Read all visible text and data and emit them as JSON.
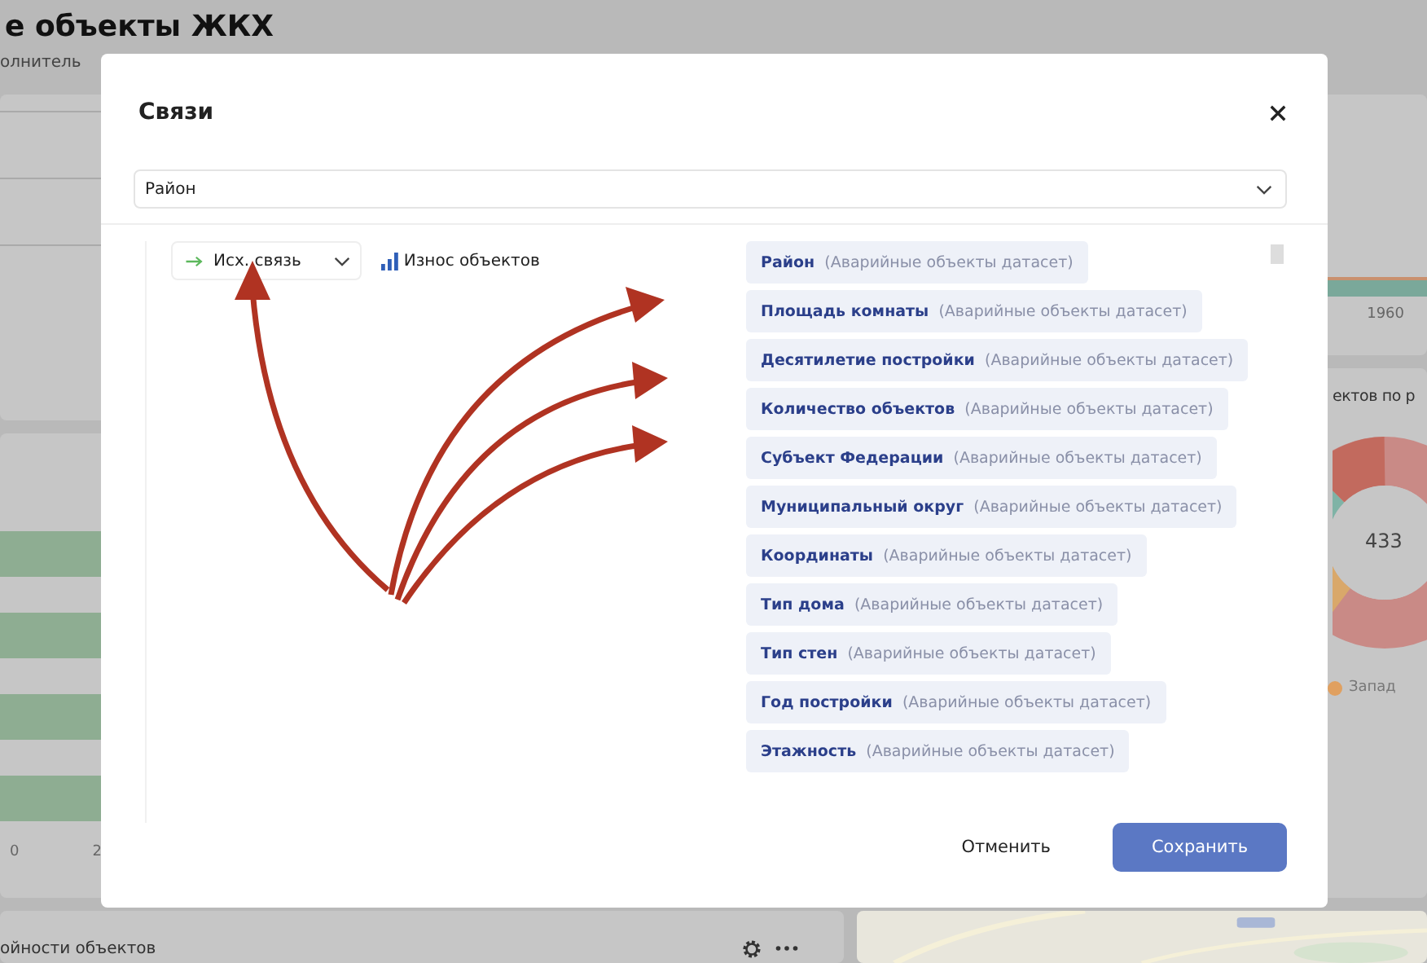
{
  "page": {
    "title": "е объекты ЖКХ",
    "tab": "олнитель"
  },
  "background": {
    "left_axis": [
      "0",
      "2"
    ],
    "area_chart_label": "1960",
    "donut_title": "ектов по р",
    "donut_total": "433",
    "legend_item": {
      "label": "Запад",
      "color": "#e0a060"
    },
    "bottom_card_title": "ойности объектов"
  },
  "dialog": {
    "title": "Связи",
    "dataset_select": {
      "value": "Район"
    },
    "link_type": {
      "label": "Исх. связь"
    },
    "chart_name": "Износ объектов",
    "fields": [
      {
        "name": "Район",
        "source": "(Аварийные объекты датасет)"
      },
      {
        "name": "Площадь комнаты",
        "source": "(Аварийные объекты датасет)"
      },
      {
        "name": "Десятилетие постройки",
        "source": "(Аварийные объекты датасет)"
      },
      {
        "name": "Количество объектов",
        "source": "(Аварийные объекты датасет)"
      },
      {
        "name": "Субъект Федерации",
        "source": "(Аварийные объекты датасет)"
      },
      {
        "name": "Муниципальный округ",
        "source": "(Аварийные объекты датасет)"
      },
      {
        "name": "Координаты",
        "source": "(Аварийные объекты датасет)"
      },
      {
        "name": "Тип дома",
        "source": "(Аварийные объекты датасет)"
      },
      {
        "name": "Тип стен",
        "source": "(Аварийные объекты датасет)"
      },
      {
        "name": "Год постройки",
        "source": "(Аварийные объекты датасет)"
      },
      {
        "name": "Этажность",
        "source": "(Аварийные объекты датасет)"
      }
    ],
    "cancel": "Отменить",
    "save": "Сохранить"
  }
}
